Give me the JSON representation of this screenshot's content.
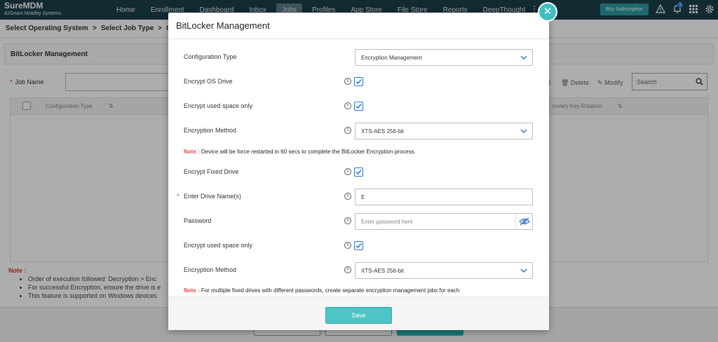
{
  "app": {
    "name": "SureMDM",
    "company": "42Gears Mobility Systems",
    "nav": [
      "Home",
      "Enrollment",
      "Dashboard",
      "Inbox",
      "Jobs",
      "Profiles",
      "App Store",
      "File Store",
      "Reports",
      "DeepThought"
    ],
    "active_nav": "Jobs",
    "buy_label": "Buy Subscription",
    "notification_count": "1"
  },
  "breadcrumb": {
    "step1": "Select Operating System",
    "sep": ">",
    "step2": "Select Job Type",
    "step3": "C"
  },
  "background_page": {
    "section_title": "BitLocker Management",
    "job_name_label": "Job Name",
    "toolbar": {
      "add": "d",
      "delete": "Delete",
      "modify": "Modify",
      "search_placeholder": "Search"
    },
    "table_headers": [
      "Configuration Type",
      "covery Key Rotation"
    ],
    "note_title": "Note :",
    "notes": [
      "Order of execution followed: Decryption > Enc",
      "For successful Encryption, ensure the drive is e",
      "This feature is supported on Windows devices"
    ]
  },
  "modal": {
    "title": "BitLocker Management",
    "config_type_label": "Configuration Type",
    "config_type_value": "Encryption Management",
    "encrypt_os_label": "Encrypt OS Drive",
    "encrypt_os_checked": true,
    "used_space_label": "Encrypt used space only",
    "used_space_checked": true,
    "method_label": "Encryption Method",
    "method_value": "XTS-AES 256-bit",
    "note1_prefix": "Note :",
    "note1_text": " Device will be force restarted in 60 secs to complete the BitLocker Encryption process.",
    "fixed_label": "Encrypt Fixed Drive",
    "fixed_checked": true,
    "drive_names_label": "Enter Drive Name(s)",
    "drive_names_value": "E",
    "password_label": "Password",
    "password_placeholder": "Enter password here",
    "fixed_used_space_label": "Encrypt used space only",
    "fixed_used_space_checked": true,
    "fixed_method_label": "Encryption Method",
    "fixed_method_value": "XTS-AES 256-bit",
    "note2_prefix": "Note :",
    "note2_text": " For multiple fixed drives with different passwords, create separate encryption management jobs for each",
    "save_label": "Save"
  },
  "colors": {
    "nav_bg": "#1b3f4b",
    "accent": "#4dc5c7",
    "checkbox": "#2e74c9",
    "required": "#d33333"
  }
}
